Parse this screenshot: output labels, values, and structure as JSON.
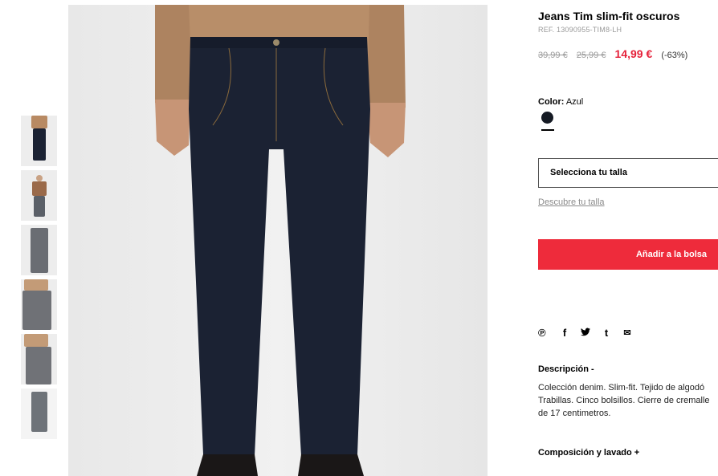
{
  "product": {
    "title": "Jeans Tim slim-fit oscuros",
    "ref": "REF. 13090955-TIM8-LH",
    "price_original": "39,99 €",
    "price_previous": "25,99 €",
    "price_current": "14,99 €",
    "discount": "(-63%)",
    "color_label": "Color:",
    "color_value": "Azul",
    "swatch_color": "#151a24",
    "size_placeholder": "Selecciona tu talla",
    "size_guide": "Descubre tu talla",
    "add_to_bag": "Añadir a la bolsa"
  },
  "share": {
    "icons": [
      "pinterest-icon",
      "facebook-icon",
      "twitter-icon",
      "tumblr-icon",
      "email-icon"
    ],
    "glyphs": [
      "℗",
      "f",
      "🐦",
      "t",
      "✉"
    ]
  },
  "description": {
    "heading": "Descripción -",
    "line1": "Colección denim. Slim-fit. Tejido de algodó",
    "line2": "Trabillas. Cinco bolsillos. Cierre de cremalle",
    "line3": "de 17 centimetros."
  },
  "composition": {
    "heading": "Composición y lavado +"
  },
  "colors": {
    "accent": "#ee2b3b",
    "price_red": "#e5213a",
    "denim": "#1b2233"
  }
}
